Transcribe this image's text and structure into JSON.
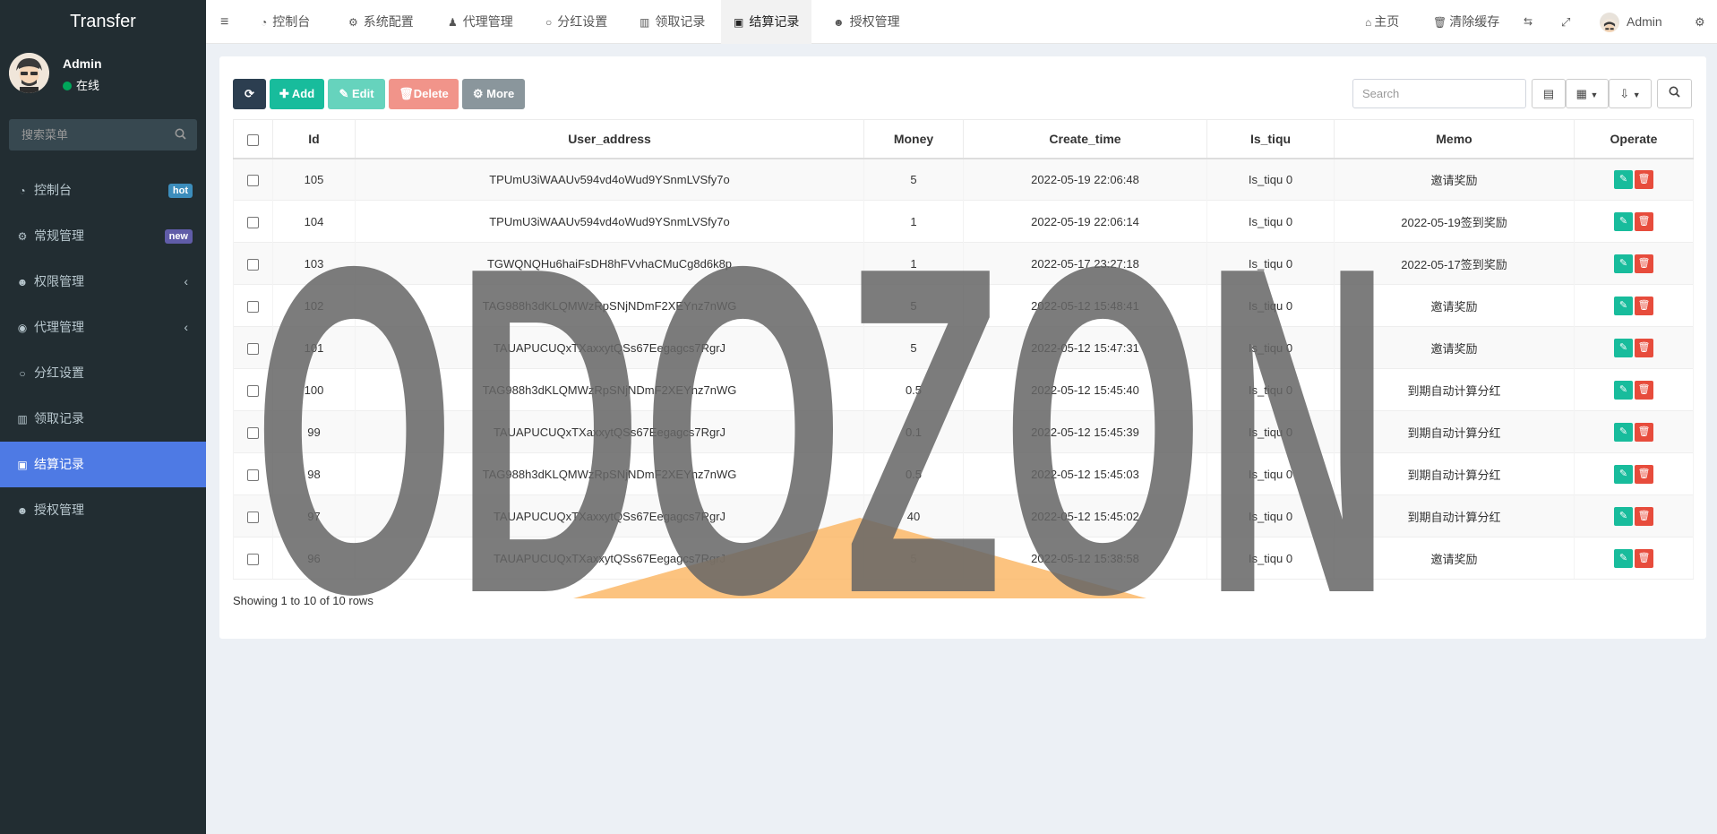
{
  "brand": "Transfer",
  "user": {
    "name": "Admin",
    "status": "在线"
  },
  "menu_search": {
    "placeholder": "搜索菜单"
  },
  "sidebar": {
    "items": [
      {
        "label": "控制台",
        "badge": "hot"
      },
      {
        "label": "常规管理",
        "badge": "new"
      },
      {
        "label": "权限管理"
      },
      {
        "label": "代理管理"
      },
      {
        "label": "分红设置"
      },
      {
        "label": "领取记录"
      },
      {
        "label": "结算记录"
      },
      {
        "label": "授权管理"
      }
    ]
  },
  "topnav": {
    "tabs": [
      "控制台",
      "系统配置",
      "代理管理",
      "分红设置",
      "领取记录",
      "结算记录",
      "授权管理"
    ],
    "home": "主页",
    "clear_cache": "清除缓存",
    "admin": "Admin"
  },
  "toolbar": {
    "add": "Add",
    "edit": "Edit",
    "delete": "Delete",
    "more": "More"
  },
  "search": {
    "placeholder": "Search"
  },
  "table": {
    "headers": [
      "Id",
      "User_address",
      "Money",
      "Create_time",
      "Is_tiqu",
      "Memo",
      "Operate"
    ],
    "rows": [
      {
        "id": "105",
        "address": "TPUmU3iWAAUv594vd4oWud9YSnmLVSfy7o",
        "money": "5",
        "time": "2022-05-19 22:06:48",
        "tiqu": "Is_tiqu 0",
        "memo": "邀请奖励"
      },
      {
        "id": "104",
        "address": "TPUmU3iWAAUv594vd4oWud9YSnmLVSfy7o",
        "money": "1",
        "time": "2022-05-19 22:06:14",
        "tiqu": "Is_tiqu 0",
        "memo": "2022-05-19签到奖励"
      },
      {
        "id": "103",
        "address": "TGWQNQHu6haiFsDH8hFVvhaCMuCg8d6k8p",
        "money": "1",
        "time": "2022-05-17 23:27:18",
        "tiqu": "Is_tiqu 0",
        "memo": "2022-05-17签到奖励"
      },
      {
        "id": "102",
        "address": "TAG988h3dKLQMWzRpSNjNDmF2XEYnz7nWG",
        "money": "5",
        "time": "2022-05-12 15:48:41",
        "tiqu": "Is_tiqu 0",
        "memo": "邀请奖励"
      },
      {
        "id": "101",
        "address": "TAUAPUCUQxTXaxxytQSs67Eegagcs7RgrJ",
        "money": "5",
        "time": "2022-05-12 15:47:31",
        "tiqu": "Is_tiqu 0",
        "memo": "邀请奖励"
      },
      {
        "id": "100",
        "address": "TAG988h3dKLQMWzRpSNjNDmF2XEYnz7nWG",
        "money": "0.5",
        "time": "2022-05-12 15:45:40",
        "tiqu": "Is_tiqu 0",
        "memo": "到期自动计算分红"
      },
      {
        "id": "99",
        "address": "TAUAPUCUQxTXaxxytQSs67Eegagcs7RgrJ",
        "money": "0.1",
        "time": "2022-05-12 15:45:39",
        "tiqu": "Is_tiqu 0",
        "memo": "到期自动计算分红"
      },
      {
        "id": "98",
        "address": "TAG988h3dKLQMWzRpSNjNDmF2XEYnz7nWG",
        "money": "0.5",
        "time": "2022-05-12 15:45:03",
        "tiqu": "Is_tiqu 0",
        "memo": "到期自动计算分红"
      },
      {
        "id": "97",
        "address": "TAUAPUCUQxTXaxxytQSs67Eegagcs7RgrJ",
        "money": "40",
        "time": "2022-05-12 15:45:02",
        "tiqu": "Is_tiqu 0",
        "memo": "到期自动计算分红"
      },
      {
        "id": "96",
        "address": "TAUAPUCUQxTXaxxytQSs67Eegagcs7RgrJ",
        "money": "5",
        "time": "2022-05-12 15:38:58",
        "tiqu": "Is_tiqu 0",
        "memo": "邀请奖励"
      }
    ]
  },
  "pagination": {
    "summary": "Showing 1 to 10 of 10 rows"
  },
  "watermark": {
    "text": "ODOZON"
  },
  "colors": {
    "sidebar": "#222d32",
    "active": "#4e7ae4",
    "add": "#18bc9c",
    "edit": "#66d3bd",
    "delete": "#f1948a",
    "more": "#8a969c",
    "hot": "#3c8dbc",
    "new": "#605ca8",
    "primary": "#2c3e50"
  }
}
